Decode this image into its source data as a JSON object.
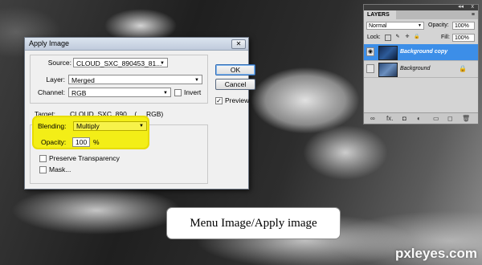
{
  "dialog": {
    "title": "Apply Image",
    "close_glyph": "✕",
    "source_label": "Source:",
    "source_value": "CLOUD_SXC_890453_81...",
    "layer_label": "Layer:",
    "layer_value": "Merged",
    "channel_label": "Channel:",
    "channel_value": "RGB",
    "invert_label": "Invert",
    "target_label": "Target:",
    "target_value": "CLOUD_SXC_890... (..., RGB)",
    "blending_label": "Blending:",
    "blending_value": "Multiply",
    "opacity_label": "Opacity:",
    "opacity_value": "100",
    "opacity_unit": "%",
    "preserve_label": "Preserve Transparency",
    "mask_label": "Mask...",
    "ok_label": "OK",
    "cancel_label": "Cancel",
    "preview_label": "Preview",
    "preview_checked": "✓"
  },
  "layers_panel": {
    "tab_label": "LAYERS",
    "collapse_glyph": "◂◂",
    "close_glyph": "x",
    "menu_glyph": "≡",
    "blend_mode": "Normal",
    "opacity_label": "Opacity:",
    "opacity_value": "100%",
    "lock_label": "Lock:",
    "fill_label": "Fill:",
    "fill_value": "100%",
    "layers": [
      {
        "name": "Background copy",
        "selected": true
      },
      {
        "name": "Background",
        "selected": false
      }
    ],
    "lock_glyph": "🔒",
    "bottom_icons": [
      "∞",
      "fx.",
      "◘",
      "◐",
      "▭",
      "◻",
      "🗑"
    ]
  },
  "caption": "Menu Image/Apply image",
  "watermark": "pxleyes.com",
  "colors": {
    "highlight": "#f3ee17",
    "selected_layer": "#3c8ee8"
  }
}
